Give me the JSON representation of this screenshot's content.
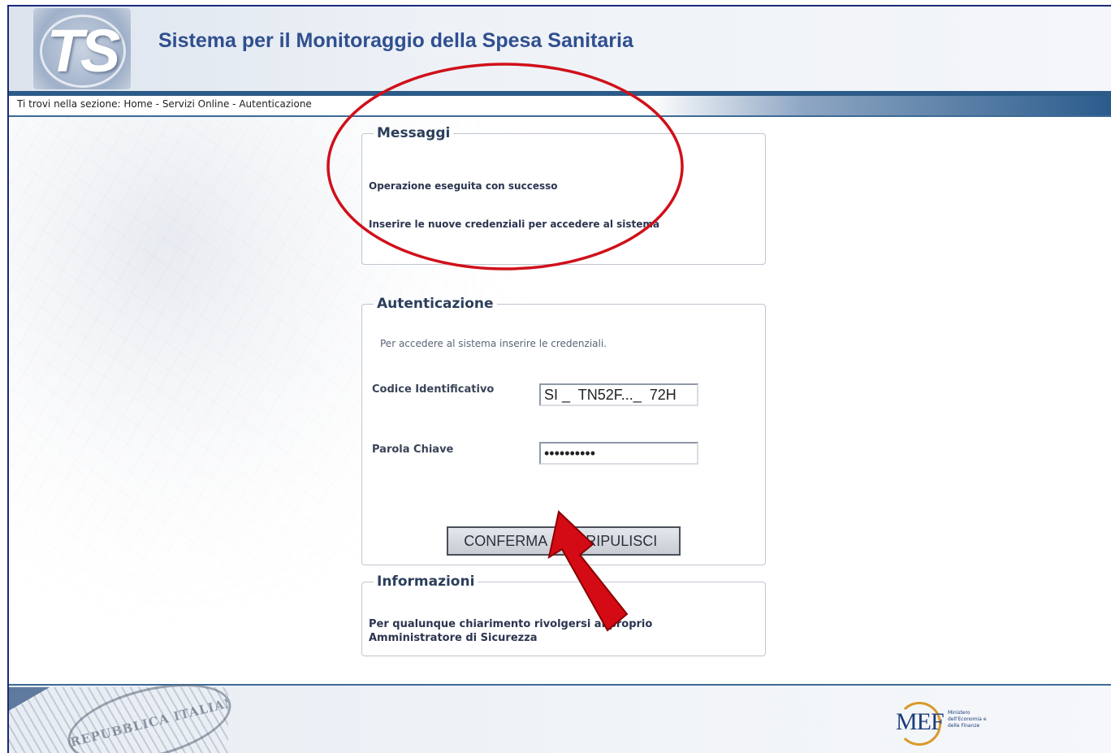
{
  "header": {
    "logo_text": "TS",
    "title": "Sistema per il Monitoraggio della Spesa Sanitaria"
  },
  "breadcrumb": {
    "prefix": "Ti trovi nella sezione:",
    "items": [
      "Home",
      "Servizi Online",
      "Autenticazione"
    ]
  },
  "messages": {
    "legend": "Messaggi",
    "lines": [
      "Operazione eseguita con successo",
      "Inserire le nuove credenziali per accedere al sistema"
    ]
  },
  "auth": {
    "legend": "Autenticazione",
    "hint": "Per accedere al sistema inserire le credenziali.",
    "code_label": "Codice Identificativo",
    "code_value": "SI _  TN52F..._  72H",
    "password_label": "Parola Chiave",
    "password_value": "••••••••••",
    "confirm_label": "CONFERMA",
    "clear_label": "RIPULISCI"
  },
  "info": {
    "legend": "Informazioni",
    "text": "Per qualunque chiarimento rivolgersi al proprio Amministratore di Sicurezza"
  },
  "footer": {
    "emblem_text": "REPUBBLICA ITALIANA",
    "mef_text": "MEF",
    "mef_sub": "Ministero dell'Economia e delle Finanze"
  },
  "colors": {
    "title": "#2f4f8f",
    "header_bar": "#2c5b88",
    "annotation_red": "#d0101a",
    "frame_border": "#1a2a7a"
  }
}
